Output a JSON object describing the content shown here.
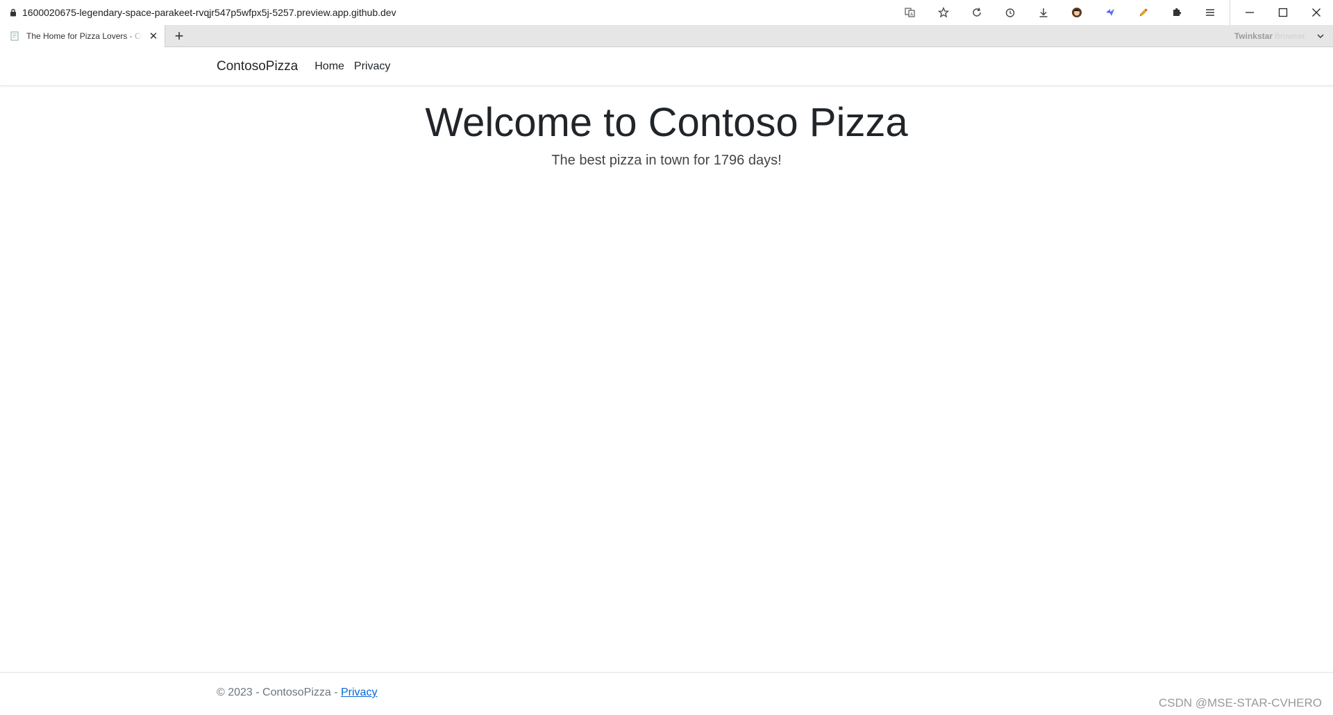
{
  "browser": {
    "url": "1600020675-legendary-space-parakeet-rvqjr547p5wfpx5j-5257.preview.app.github.dev",
    "toolbar_icons": [
      "translate-icon",
      "star-icon",
      "reload-icon",
      "history-icon",
      "download-icon",
      "profile-avatar-icon",
      "extension-blue-icon",
      "extension-pencil-icon",
      "puzzle-icon",
      "menu-icon"
    ],
    "tab": {
      "title": "The Home for Pizza Lovers - Contoso Pizza"
    },
    "brand": {
      "bold": "Twinkstar",
      "light": "Browser"
    }
  },
  "navbar": {
    "brand": "ContosoPizza",
    "links": [
      "Home",
      "Privacy"
    ]
  },
  "hero": {
    "title": "Welcome to Contoso Pizza",
    "subtitle": "The best pizza in town for 1796 days!"
  },
  "footer": {
    "text": "© 2023 - ContosoPizza - ",
    "link": "Privacy"
  },
  "watermark": "CSDN @MSE-STAR-CVHERO"
}
